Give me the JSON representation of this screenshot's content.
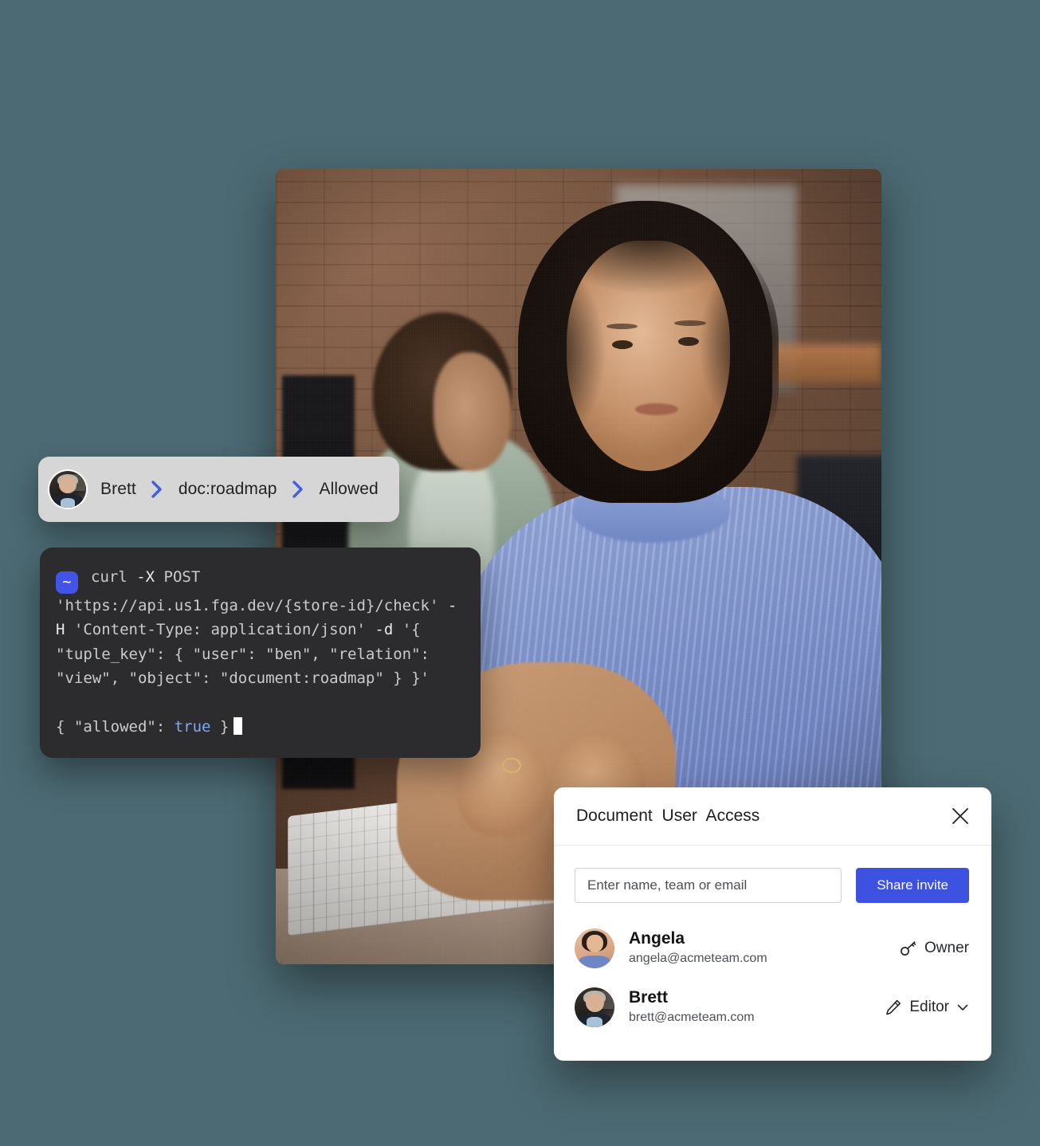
{
  "page": {
    "background_color": "#4c6a73"
  },
  "hero_photo": {
    "alt": "Woman at desk typing on keyboard with colleague in background",
    "name": "office-photo"
  },
  "breadcrumb_pill": {
    "avatar_name": "brett-avatar",
    "steps": [
      {
        "label": "Brett"
      },
      {
        "label": "doc:roadmap"
      },
      {
        "label": "Allowed"
      }
    ],
    "chevron_color": "#3f5fe0"
  },
  "terminal": {
    "prompt_glyph": "~",
    "prompt_color": "#4254e8",
    "command_parts": [
      {
        "text": "curl ",
        "type": "plain"
      },
      {
        "text": "-X",
        "type": "flag"
      },
      {
        "text": " POST 'https://api.us1.fga.dev/{store-id}/check' ",
        "type": "plain"
      },
      {
        "text": "-H",
        "type": "flag"
      },
      {
        "text": " 'Content-Type: application/json' ",
        "type": "plain"
      },
      {
        "text": "-d",
        "type": "flag"
      },
      {
        "text": " '{ \"tuple_key\": { \"user\": \"ben\", \"relation\": \"view\", \"object\": \"document:roadmap\" } }'",
        "type": "plain"
      }
    ],
    "command_plain": "curl -X POST 'https://api.us1.fga.dev/{store-id}/check' -H 'Content-Type: application/json' -d '{ \"tuple_key\": { \"user\": \"ben\", \"relation\": \"view\", \"object\": \"document:roadmap\" } }'",
    "output_prefix": "{ \"allowed\": ",
    "output_value": "true",
    "output_suffix": " }",
    "background_color": "#2c2c2f"
  },
  "share_panel": {
    "title": "Document  User  Access",
    "close_icon": "close-icon",
    "invite": {
      "placeholder": "Enter name, team or email",
      "value": "",
      "button_label": "Share invite",
      "button_color": "#3d52e0"
    },
    "members": [
      {
        "name": "Angela",
        "email": "angela@acmeteam.com",
        "role": "Owner",
        "role_icon": "key-icon",
        "has_dropdown": false,
        "avatar_name": "angela-avatar"
      },
      {
        "name": "Brett",
        "email": "brett@acmeteam.com",
        "role": "Editor",
        "role_icon": "pencil-icon",
        "has_dropdown": true,
        "avatar_name": "brett-avatar"
      }
    ]
  }
}
